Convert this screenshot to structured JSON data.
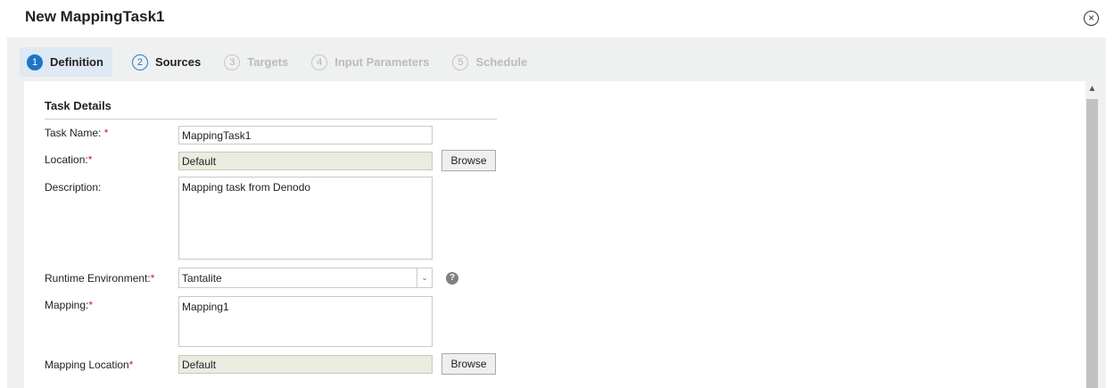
{
  "header": {
    "title": "New MappingTask1",
    "close_icon": "close-circle-icon",
    "close_glyph": "×"
  },
  "steps": [
    {
      "num": "1",
      "label": "Definition",
      "state": "active"
    },
    {
      "num": "2",
      "label": "Sources",
      "state": "enabled"
    },
    {
      "num": "3",
      "label": "Targets",
      "state": "disabled"
    },
    {
      "num": "4",
      "label": "Input Parameters",
      "state": "disabled"
    },
    {
      "num": "5",
      "label": "Schedule",
      "state": "disabled"
    }
  ],
  "form": {
    "section_title": "Task Details",
    "task_name": {
      "label": "Task Name:",
      "required": "*",
      "value": "MappingTask1"
    },
    "location": {
      "label": "Location:",
      "required": "*",
      "value": "Default",
      "browse": "Browse"
    },
    "description": {
      "label": "Description:",
      "value": "Mapping task from Denodo"
    },
    "runtime_environment": {
      "label": "Runtime Environment:",
      "required": "*",
      "value": "Tantalite",
      "help": "?"
    },
    "mapping": {
      "label": "Mapping:",
      "required": "*",
      "value": "Mapping1"
    },
    "mapping_location": {
      "label": "Mapping Location",
      "required": "*",
      "value": "Default",
      "browse": "Browse"
    }
  },
  "colors": {
    "accent": "#1f74c6",
    "required": "#d42020",
    "readonly_bg": "#ecebe0"
  }
}
